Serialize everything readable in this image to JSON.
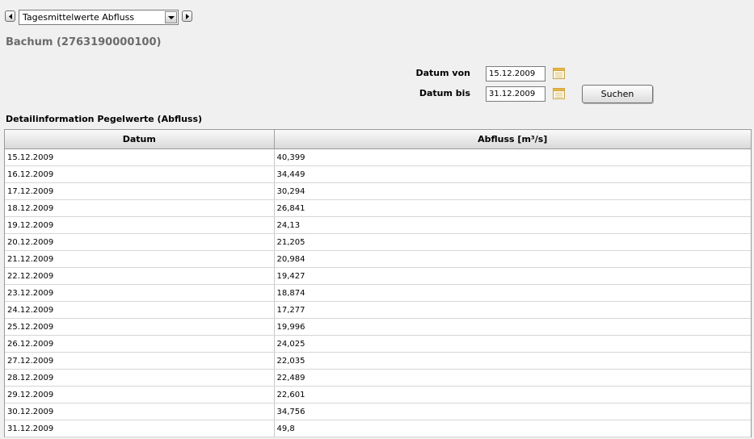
{
  "toolbar": {
    "select_value": "Tagesmittelwerte Abfluss"
  },
  "station": {
    "title": "Bachum (2763190000100)"
  },
  "filter": {
    "from_label": "Datum von",
    "from_value": "15.12.2009",
    "to_label": "Datum bis",
    "to_value": "31.12.2009",
    "search_label": "Suchen"
  },
  "section": {
    "title": "Detailinformation Pegelwerte (Abfluss)"
  },
  "table": {
    "columns": [
      "Datum",
      "Abfluss [m³/s]"
    ],
    "rows": [
      [
        "15.12.2009",
        "40,399"
      ],
      [
        "16.12.2009",
        "34,449"
      ],
      [
        "17.12.2009",
        "30,294"
      ],
      [
        "18.12.2009",
        "26,841"
      ],
      [
        "19.12.2009",
        "24,13"
      ],
      [
        "20.12.2009",
        "21,205"
      ],
      [
        "21.12.2009",
        "20,984"
      ],
      [
        "22.12.2009",
        "19,427"
      ],
      [
        "23.12.2009",
        "18,874"
      ],
      [
        "24.12.2009",
        "17,277"
      ],
      [
        "25.12.2009",
        "19,996"
      ],
      [
        "26.12.2009",
        "24,025"
      ],
      [
        "27.12.2009",
        "22,035"
      ],
      [
        "28.12.2009",
        "22,489"
      ],
      [
        "29.12.2009",
        "22,601"
      ],
      [
        "30.12.2009",
        "34,756"
      ],
      [
        "31.12.2009",
        "49,8"
      ]
    ]
  },
  "icons": {
    "prev": "arrow-left-icon",
    "next": "arrow-right-icon",
    "dropdown": "chevron-down-icon",
    "calendar": "calendar-icon"
  }
}
